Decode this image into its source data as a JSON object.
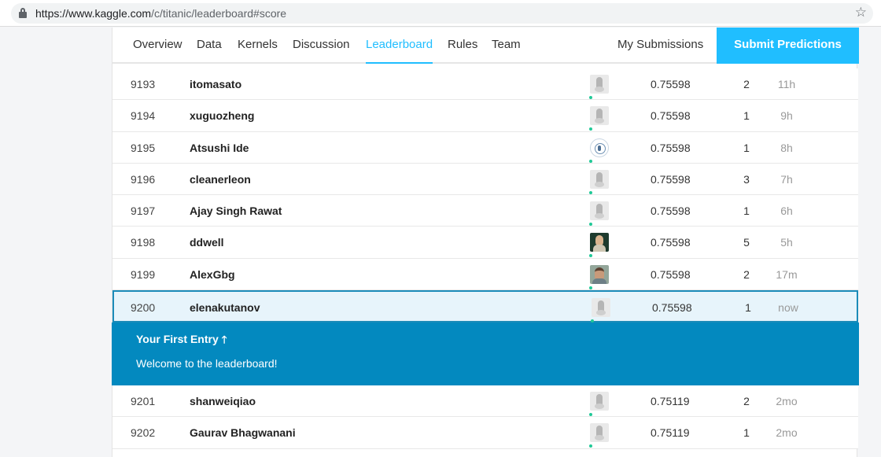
{
  "browser": {
    "url_host": "https://www.kaggle.com",
    "url_path": "/c/titanic/leaderboard#score"
  },
  "tabs": [
    {
      "label": "Overview"
    },
    {
      "label": "Data"
    },
    {
      "label": "Kernels"
    },
    {
      "label": "Discussion"
    },
    {
      "label": "Leaderboard",
      "active": true
    },
    {
      "label": "Rules"
    },
    {
      "label": "Team"
    }
  ],
  "my_submissions_label": "My Submissions",
  "submit_label": "Submit Predictions",
  "rows_before": [
    {
      "rank": "9193",
      "name": "itomasato",
      "avatar": "default-avatar-icon",
      "score": "0.75598",
      "entries": "2",
      "last": "11h"
    },
    {
      "rank": "9194",
      "name": "xuguozheng",
      "avatar": "default-avatar-icon",
      "score": "0.75598",
      "entries": "1",
      "last": "9h"
    },
    {
      "rank": "9195",
      "name": "Atsushi Ide",
      "avatar": "seal-avatar-icon",
      "score": "0.75598",
      "entries": "1",
      "last": "8h"
    },
    {
      "rank": "9196",
      "name": "cleanerleon",
      "avatar": "default-avatar-icon",
      "score": "0.75598",
      "entries": "3",
      "last": "7h"
    },
    {
      "rank": "9197",
      "name": "Ajay Singh Rawat",
      "avatar": "default-avatar-icon",
      "score": "0.75598",
      "entries": "1",
      "last": "6h"
    },
    {
      "rank": "9198",
      "name": "ddwell",
      "avatar": "photo-avatar-icon",
      "score": "0.75598",
      "entries": "5",
      "last": "5h"
    },
    {
      "rank": "9199",
      "name": "AlexGbg",
      "avatar": "photo-avatar-icon",
      "score": "0.75598",
      "entries": "2",
      "last": "17m"
    }
  ],
  "highlight_row": {
    "rank": "9200",
    "name": "elenakutanov",
    "avatar": "default-avatar-icon",
    "score": "0.75598",
    "entries": "1",
    "last": "now"
  },
  "entry_banner": {
    "title": "Your First Entry",
    "arrow": "🡑",
    "message": "Welcome to the leaderboard!"
  },
  "rows_after": [
    {
      "rank": "9201",
      "name": "shanweiqiao",
      "avatar": "default-avatar-icon",
      "score": "0.75119",
      "entries": "2",
      "last": "2mo"
    },
    {
      "rank": "9202",
      "name": "Gaurav Bhagwanani",
      "avatar": "default-avatar-icon",
      "score": "0.75119",
      "entries": "1",
      "last": "2mo"
    }
  ],
  "colors": {
    "accent": "#20beff",
    "banner": "#0389bf",
    "highlight_border": "#1b8bb9",
    "highlight_bg": "#e7f4fb",
    "online_dot": "#20c997"
  }
}
